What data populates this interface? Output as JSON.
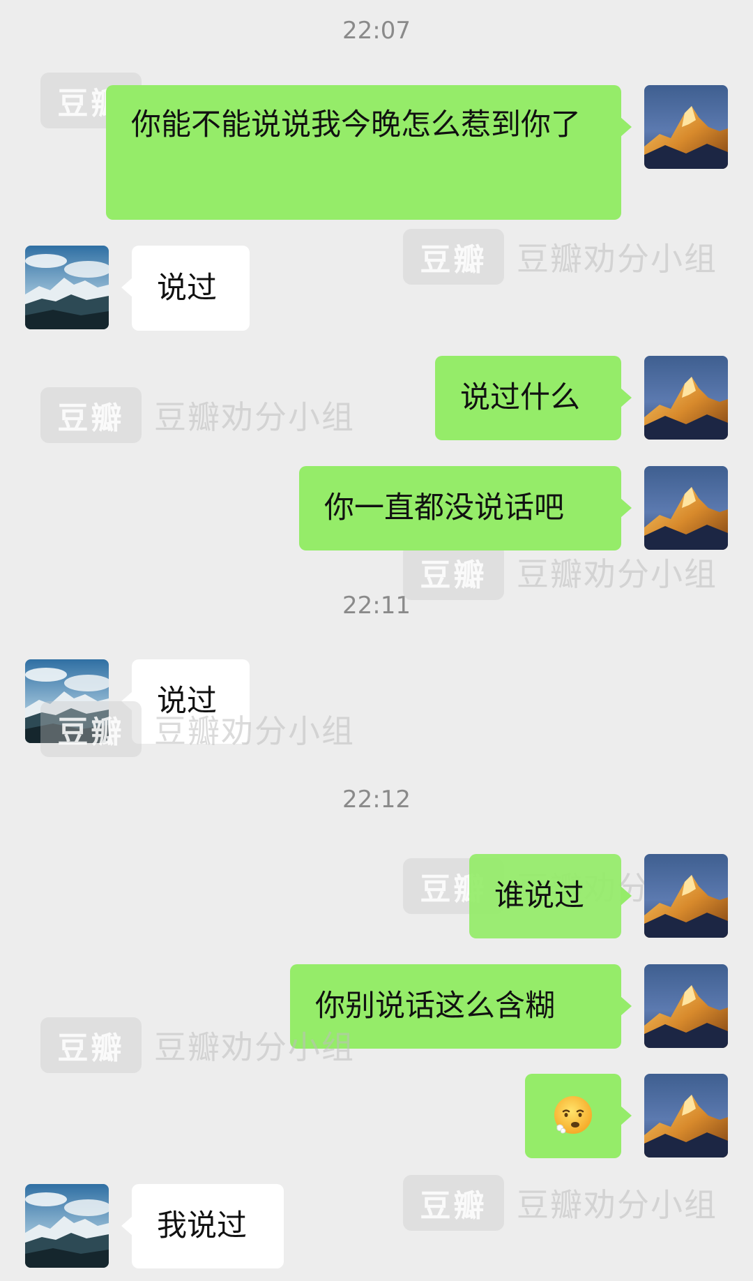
{
  "watermark": {
    "box": "豆瓣",
    "text": "豆瓣劝分小组"
  },
  "timestamps": [
    "22:07",
    "22:11",
    "22:12"
  ],
  "messages": [
    {
      "side": "self",
      "text": "你能不能说说我今晚怎么惹到你了"
    },
    {
      "side": "other",
      "text": "说过"
    },
    {
      "side": "self",
      "text": "说过什么"
    },
    {
      "side": "self",
      "text": "你一直都没说话吧"
    },
    {
      "side": "other",
      "text": "说过"
    },
    {
      "side": "self",
      "text": "谁说过"
    },
    {
      "side": "self",
      "text": "你别说话这么含糊"
    },
    {
      "side": "self",
      "emoji": "face-with-steam-emoji"
    },
    {
      "side": "other",
      "text": "我说过"
    }
  ],
  "colors": {
    "background": "#ededed",
    "self_bubble": "#95ec69",
    "other_bubble": "#ffffff",
    "timestamp": "#8a8a8a"
  }
}
